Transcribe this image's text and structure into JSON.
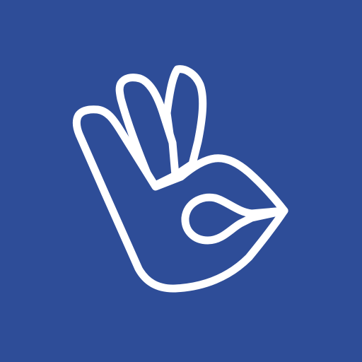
{
  "icon": {
    "name": "ok-hand-gesture-icon",
    "background_color": "#2e4d98",
    "stroke_color": "#ffffff"
  }
}
